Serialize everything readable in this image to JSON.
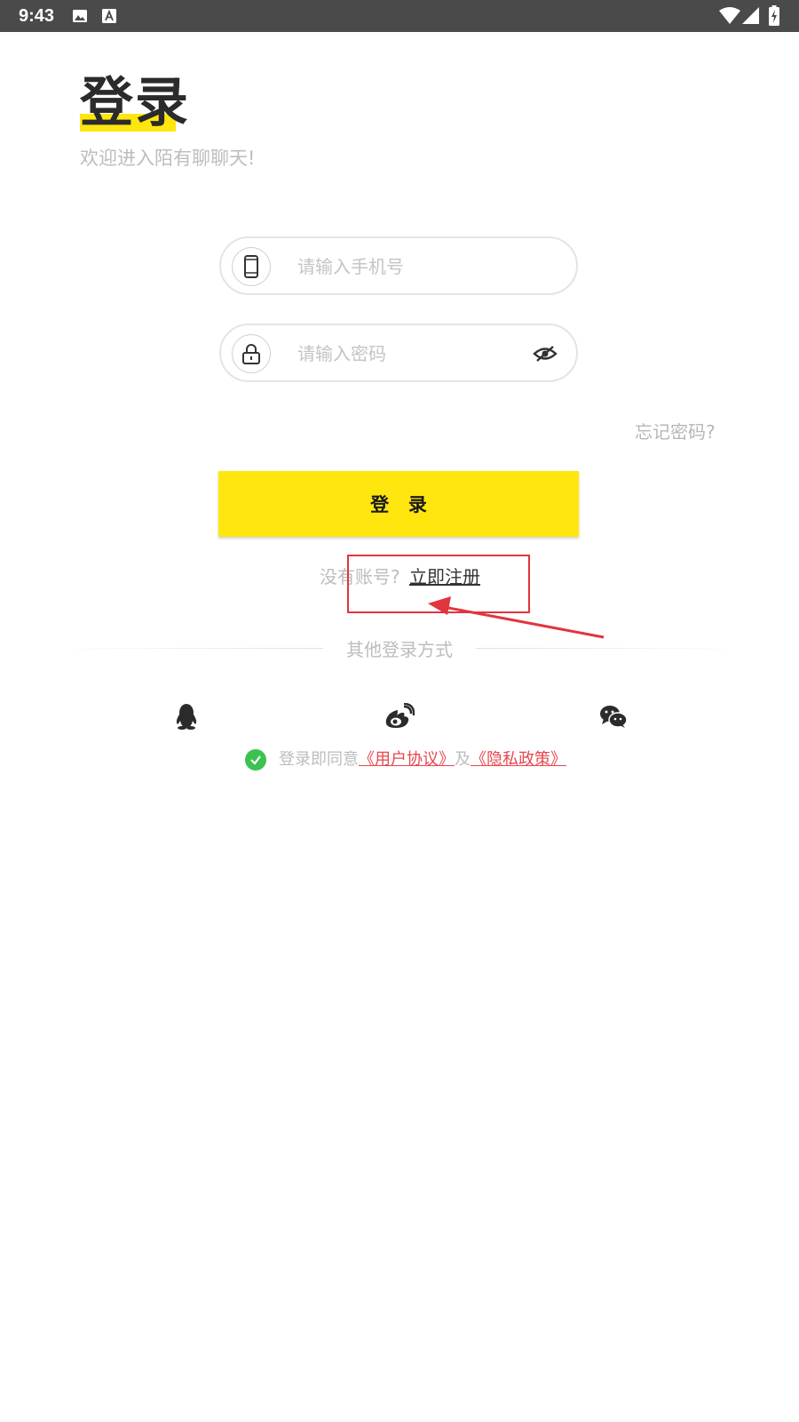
{
  "status_bar": {
    "time": "9:43",
    "icons": [
      "image-icon",
      "font-a-icon",
      "wifi-icon",
      "signal-icon",
      "battery-charging-icon"
    ]
  },
  "header": {
    "title": "登录",
    "subtitle": "欢迎进入陌有聊聊天!"
  },
  "form": {
    "phone": {
      "icon": "phone-icon",
      "placeholder": "请输入手机号",
      "value": ""
    },
    "password": {
      "icon": "lock-icon",
      "placeholder": "请输入密码",
      "value": "",
      "toggle_icon": "eye-off-icon"
    },
    "forgot_password": "忘记密码?",
    "login_button": "登 录"
  },
  "register": {
    "prompt": "没有账号?",
    "link": "立即注册"
  },
  "other_login": {
    "label": "其他登录方式",
    "methods": [
      {
        "name": "QQ",
        "icon": "qq-icon"
      },
      {
        "name": "Weibo",
        "icon": "weibo-icon"
      },
      {
        "name": "WeChat",
        "icon": "wechat-icon"
      }
    ]
  },
  "agreement": {
    "checked": true,
    "prefix": "登录即同意",
    "user_agreement": "《用户协议》",
    "connector": "及",
    "privacy_policy": "《隐私政策》"
  },
  "colors": {
    "accent_yellow": "#ffe60f",
    "annotation_red": "#e0353f",
    "link_red": "#e6474e",
    "check_green": "#3cc250"
  }
}
